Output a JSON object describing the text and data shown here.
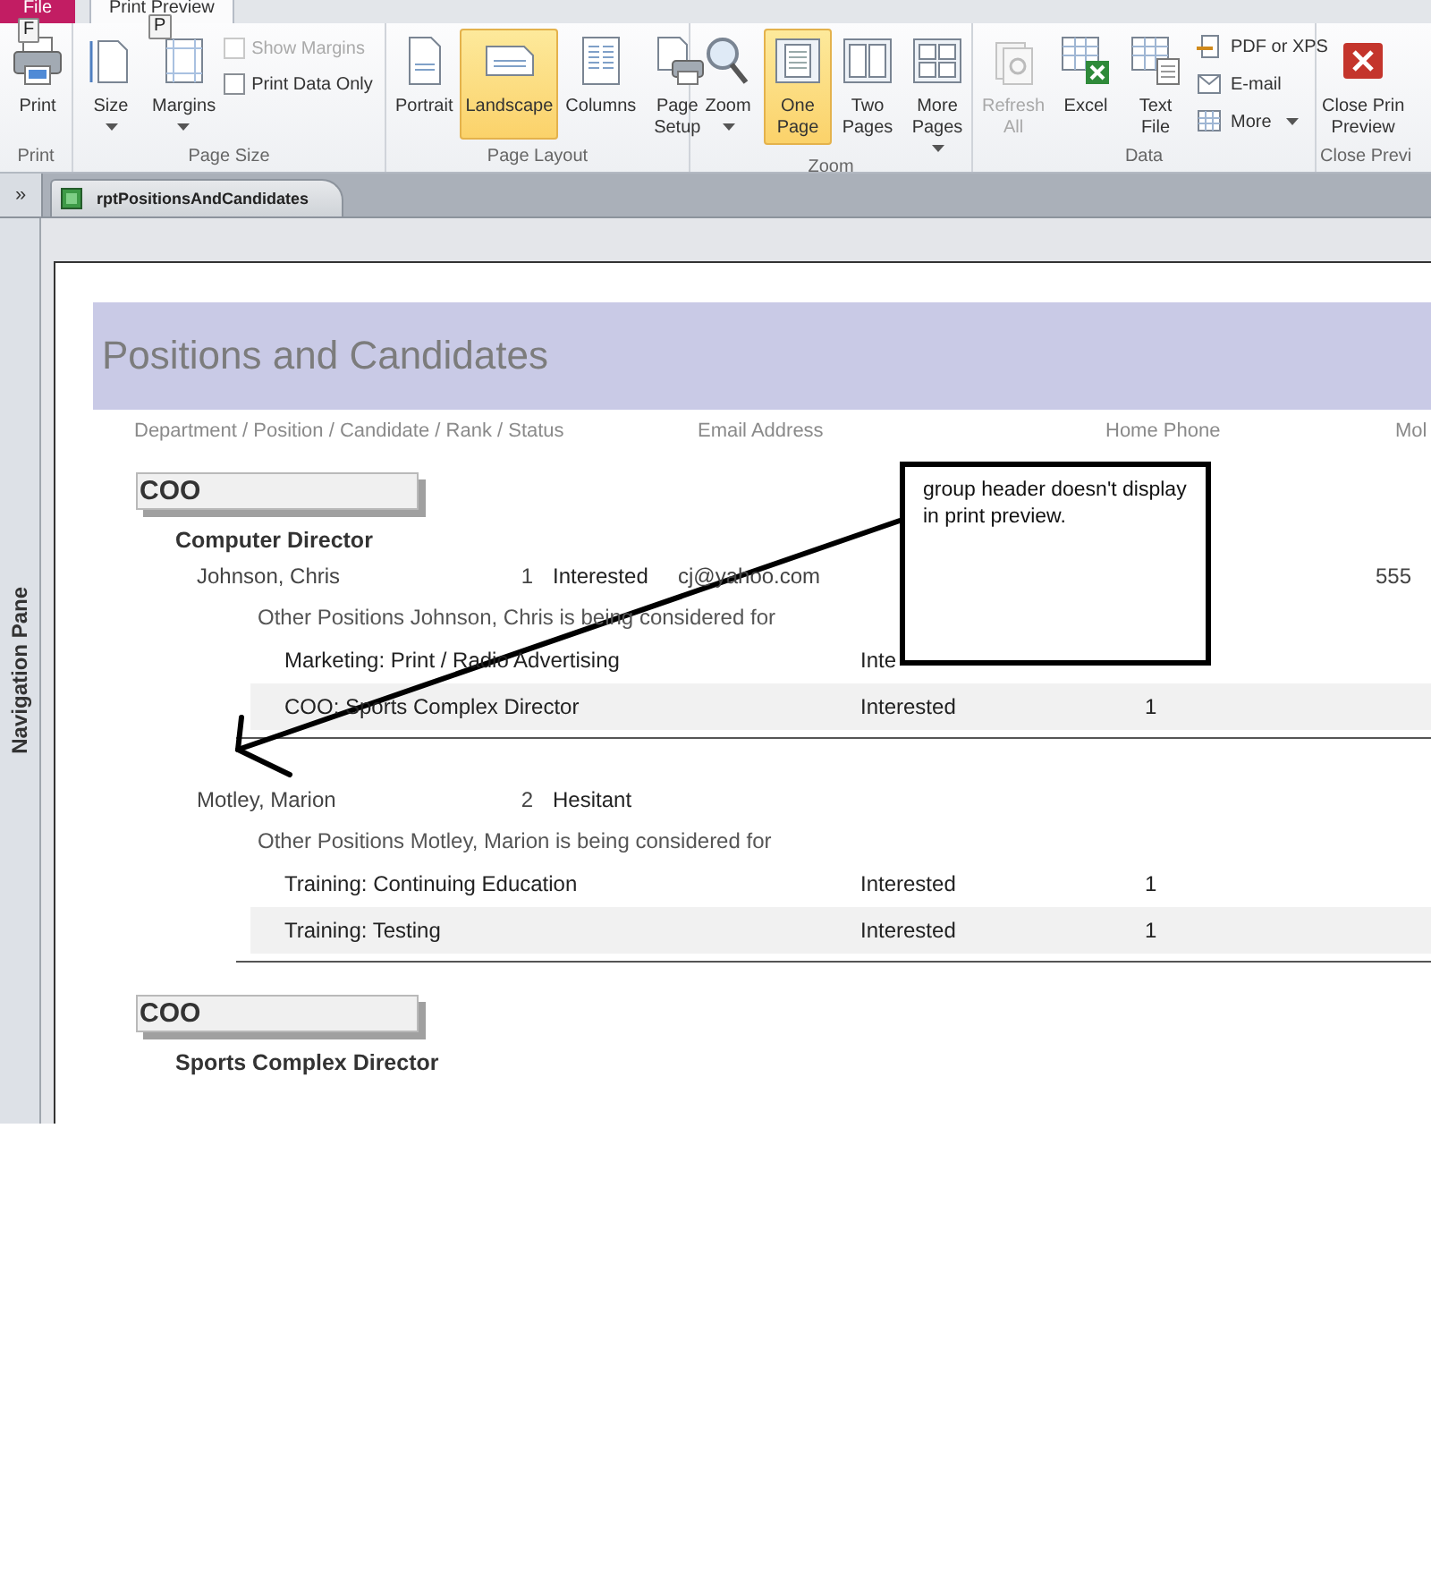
{
  "ribbon": {
    "tabs": [
      {
        "label": "File",
        "kind": "file",
        "selected": false,
        "keytip": "F"
      },
      {
        "label": "Print Preview",
        "kind": "tab",
        "selected": true,
        "keytip": "P"
      }
    ],
    "groups": [
      {
        "label": "Print",
        "items": [
          {
            "kind": "large",
            "label": [
              "Print"
            ]
          }
        ]
      },
      {
        "label": "Page Size",
        "items": [
          {
            "kind": "large",
            "label": [
              "Size"
            ],
            "dropdown": true
          },
          {
            "kind": "large",
            "label": [
              "Margins"
            ],
            "dropdown": true
          },
          {
            "kind": "checks",
            "options": [
              {
                "label": "Show Margins",
                "checked": false,
                "disabled": true
              },
              {
                "label": "Print Data Only",
                "checked": false,
                "disabled": false
              }
            ]
          }
        ]
      },
      {
        "label": "Page Layout",
        "items": [
          {
            "kind": "large",
            "label": [
              "Portrait"
            ]
          },
          {
            "kind": "large",
            "label": [
              "Landscape"
            ],
            "selected": true
          },
          {
            "kind": "large",
            "label": [
              "Columns"
            ]
          },
          {
            "kind": "large",
            "label": [
              "Page",
              "Setup"
            ]
          }
        ]
      },
      {
        "label": "Zoom",
        "items": [
          {
            "kind": "large",
            "label": [
              "Zoom"
            ],
            "dropdown": true
          },
          {
            "kind": "large",
            "label": [
              "One",
              "Page"
            ],
            "selected": true
          },
          {
            "kind": "large",
            "label": [
              "Two",
              "Pages"
            ]
          },
          {
            "kind": "large",
            "label": [
              "More",
              "Pages"
            ],
            "dropdown": true
          }
        ]
      },
      {
        "label": "Data",
        "items": [
          {
            "kind": "large",
            "label": [
              "Refresh",
              "All"
            ],
            "disabled": true
          },
          {
            "kind": "large",
            "label": [
              "Excel"
            ]
          },
          {
            "kind": "large",
            "label": [
              "Text",
              "File"
            ]
          },
          {
            "kind": "smalls",
            "options": [
              {
                "label": "PDF or XPS"
              },
              {
                "label": "E-mail"
              },
              {
                "label": "More",
                "dropdown": true
              }
            ]
          }
        ]
      },
      {
        "label": "Close Previ",
        "items": [
          {
            "kind": "large",
            "label": [
              "Close Prin",
              "Preview"
            ]
          }
        ]
      }
    ]
  },
  "nav_toggle": "»",
  "document_tab": "rptPositionsAndCandidates",
  "navigation_pane": "Navigation Pane",
  "report": {
    "title": "Positions and Candidates",
    "columns": [
      "Department / Position / Candidate / Rank / Status",
      "Email Address",
      "Home Phone",
      "Mol"
    ],
    "groups": [
      {
        "department": "COO",
        "positions": [
          {
            "title": "Computer Director",
            "candidates": [
              {
                "name": "Johnson, Chris",
                "rank": "1",
                "status": "Interested",
                "email": "cj@yahoo.com",
                "mobile": "555",
                "other_heading": "Other Positions Johnson, Chris is being considered for",
                "others": [
                  {
                    "position": "Marketing: Print / Radio Advertising",
                    "status": "Inte"
                  },
                  {
                    "position": "COO: Sports Complex Director",
                    "status": "Interested",
                    "rank": "1"
                  }
                ]
              },
              {
                "name": "Motley, Marion",
                "rank": "2",
                "status": "Hesitant",
                "other_heading": "Other Positions Motley, Marion is being considered for",
                "others": [
                  {
                    "position": "Training: Continuing Education",
                    "status": "Interested",
                    "rank": "1"
                  },
                  {
                    "position": "Training: Testing",
                    "status": "Interested",
                    "rank": "1"
                  }
                ]
              }
            ]
          }
        ]
      },
      {
        "department": "COO",
        "positions": [
          {
            "title": "Sports Complex Director"
          }
        ]
      }
    ]
  },
  "callout": {
    "text": "group header doesn't display in print preview."
  }
}
